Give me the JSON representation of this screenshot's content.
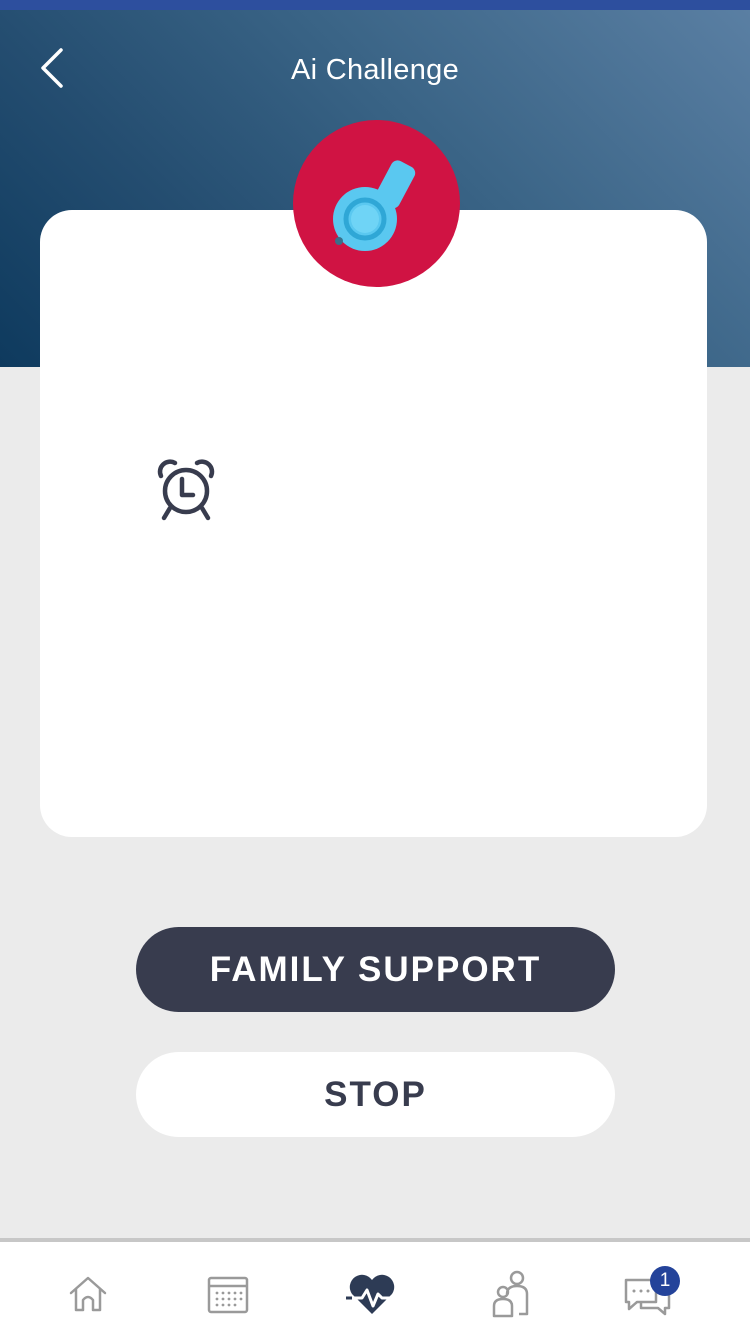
{
  "header": {
    "title": "Ai Challenge",
    "back_icon": "chevron-left-icon"
  },
  "badge_icon": "whistle-icon",
  "timer": {
    "icon": "alarm-clock-icon"
  },
  "buttons": {
    "family_support": "FAMILY SUPPORT",
    "stop": "STOP"
  },
  "tabbar": {
    "items": [
      {
        "icon": "home-icon",
        "active": false
      },
      {
        "icon": "calendar-icon",
        "active": false
      },
      {
        "icon": "heartbeat-icon",
        "active": true
      },
      {
        "icon": "family-icon",
        "active": false
      },
      {
        "icon": "chat-icon",
        "active": false,
        "badge": "1"
      }
    ]
  },
  "colors": {
    "header_gradient_start": "#5a7fa3",
    "header_gradient_end": "#0e3a5e",
    "badge_red": "#d01343",
    "whistle_blue": "#5ac8f0",
    "dark_button": "#383c4e",
    "notification_blue": "#24439a"
  }
}
